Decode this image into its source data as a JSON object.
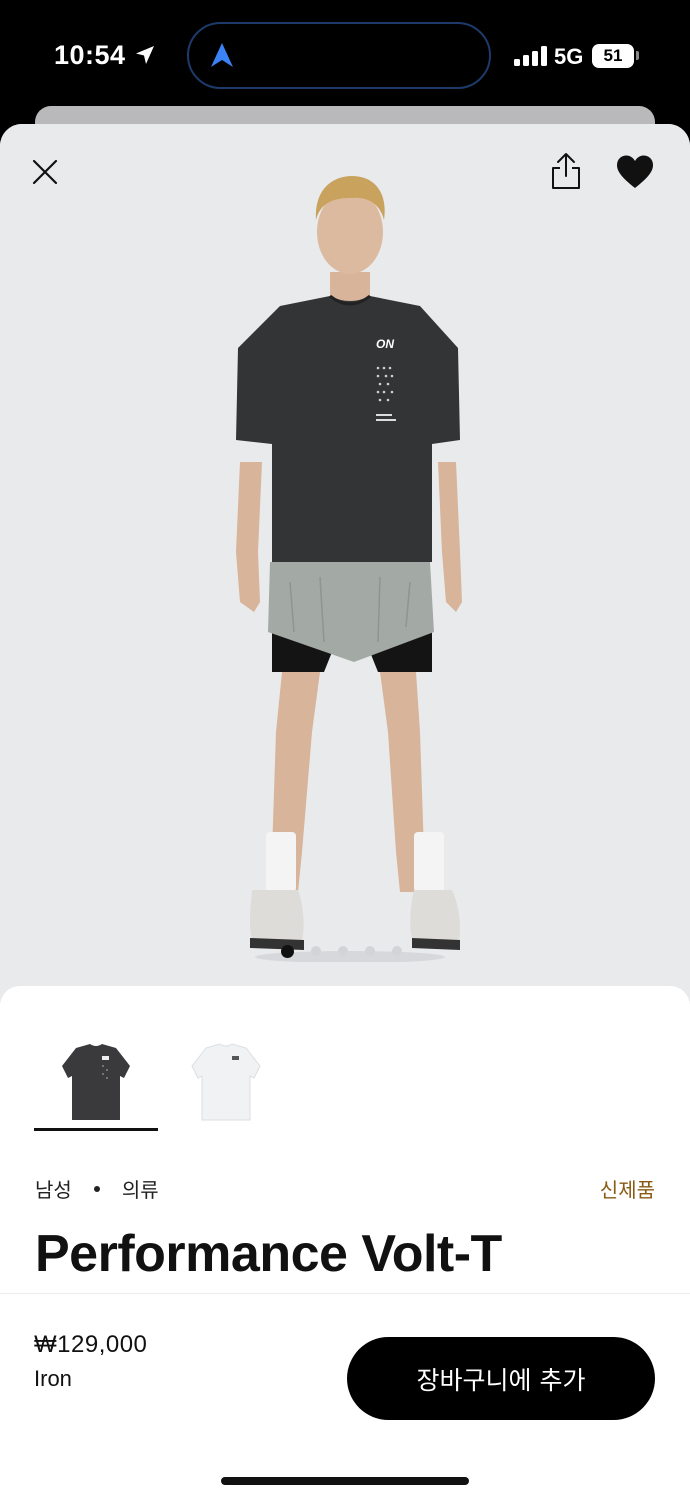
{
  "status_bar": {
    "time": "10:54",
    "network": "5G",
    "battery": "51"
  },
  "gallery": {
    "image_count": 5,
    "active_index": 0
  },
  "product": {
    "category_gender": "남성",
    "category_type": "의류",
    "badge": "신제품",
    "title": "Performance Volt-T",
    "price": "₩129,000",
    "color": "Iron",
    "swatches": [
      "dark-tee-icon",
      "white-tee-icon"
    ],
    "selected_swatch": 0
  },
  "actions": {
    "add_to_cart": "장바구니에 추가"
  },
  "colors": {
    "accent_new": "#8a5a12",
    "cta_bg": "#000000",
    "hero_bg": "#e9eaec"
  }
}
